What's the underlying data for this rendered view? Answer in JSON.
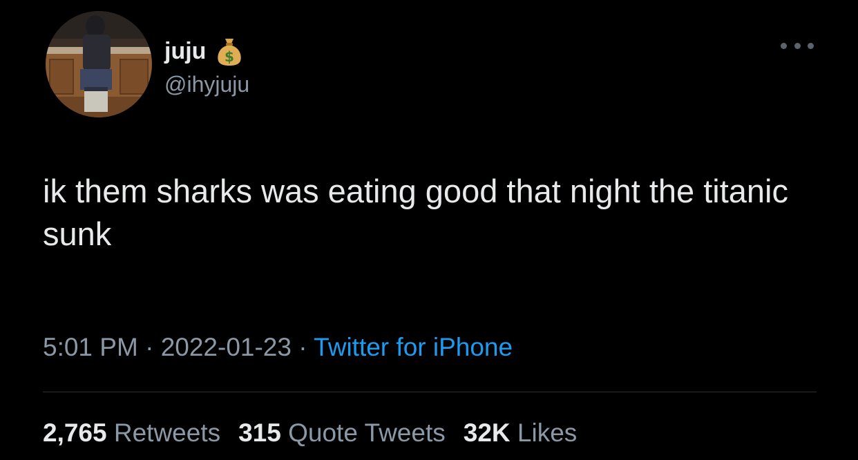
{
  "author": {
    "display_name": "juju",
    "handle": "@ihyjuju",
    "emoji_icon": "money-bag-icon"
  },
  "tweet": {
    "text": "ik them sharks was eating good that night the titanic sunk"
  },
  "meta": {
    "time": "5:01 PM",
    "separator": " · ",
    "date": "2022-01-23",
    "source": "Twitter for iPhone"
  },
  "stats": {
    "retweets_count": "2,765",
    "retweets_label": "Retweets",
    "quotes_count": "315",
    "quotes_label": "Quote Tweets",
    "likes_count": "32K",
    "likes_label": "Likes"
  },
  "colors": {
    "background": "#000000",
    "primary_text": "#e7e9ea",
    "secondary_text": "#8b98a5",
    "link": "#1d9bf0",
    "divider": "#2f3336"
  }
}
